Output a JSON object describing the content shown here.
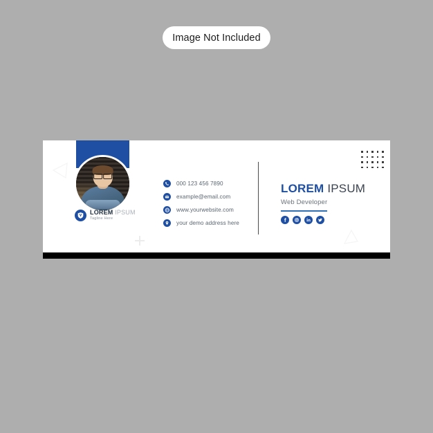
{
  "badge": {
    "label": "Image Not Included"
  },
  "card": {
    "brand": {
      "logo_icon": "shield-v-logo-icon",
      "name_primary": "LOREM",
      "name_secondary": "IPSUM",
      "tagline": "Tagline Here"
    },
    "avatar": {
      "icon": "profile-photo",
      "alt": "man with glasses"
    },
    "contacts": [
      {
        "icon": "phone-icon",
        "text": "000 123 456 7890"
      },
      {
        "icon": "email-icon",
        "text": "example@email.com"
      },
      {
        "icon": "website-icon",
        "text": "www.yourwebsite.com"
      },
      {
        "icon": "location-icon",
        "text": "your demo address here"
      }
    ],
    "identity": {
      "name_primary": "LOREM",
      "name_secondary": "IPSUM",
      "role": "Web Developer"
    },
    "social": [
      {
        "icon": "facebook-icon",
        "label": "Facebook"
      },
      {
        "icon": "instagram-icon",
        "label": "Instagram"
      },
      {
        "icon": "linkedin-icon",
        "label": "LinkedIn"
      },
      {
        "icon": "twitter-icon",
        "label": "Twitter"
      }
    ],
    "decor": {
      "dot_grid_columns": 5,
      "dot_grid_rows": 4,
      "triangle_left": "triangle-outline-left",
      "triangle_bottom_right": "triangle-outline-right",
      "plus_mark": "plus-outline"
    }
  },
  "colors": {
    "background": "#aeaeae",
    "card_background": "#ffffff",
    "brand_blue": "#1f4fa3",
    "accent_blue": "#2e6fb7",
    "text_dark": "#3b4450",
    "text_muted": "#5a6570",
    "bottom_bar": "#000000"
  }
}
